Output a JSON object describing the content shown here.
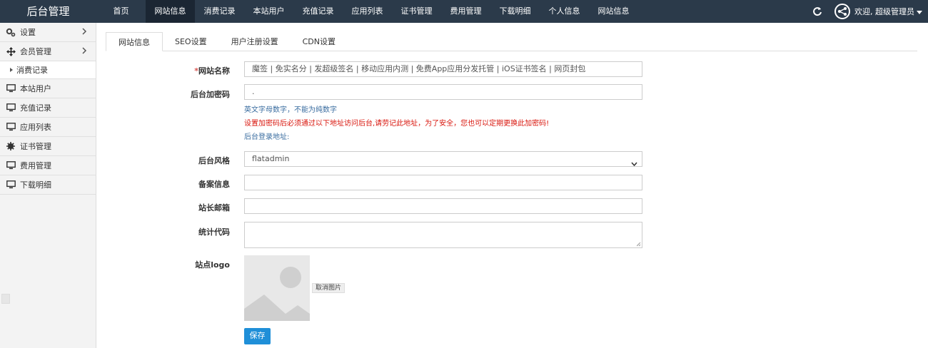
{
  "header": {
    "brand": "后台管理",
    "nav": [
      "首页",
      "网站信息",
      "消费记录",
      "本站用户",
      "充值记录",
      "应用列表",
      "证书管理",
      "费用管理",
      "下载明细",
      "个人信息",
      "网站信息"
    ],
    "active_index": 1,
    "welcome": "欢迎, 超级管理员"
  },
  "sidebar": {
    "items": [
      {
        "label": "设置",
        "icon": "gears-icon"
      },
      {
        "label": "会员管理",
        "icon": "move-arrows-icon"
      }
    ],
    "sub_item": "消费记录",
    "items2": [
      {
        "label": "本站用户",
        "icon": "monitor-icon"
      },
      {
        "label": "充值记录",
        "icon": "monitor-icon"
      },
      {
        "label": "应用列表",
        "icon": "monitor-icon"
      },
      {
        "label": "证书管理",
        "icon": "gear-icon"
      },
      {
        "label": "费用管理",
        "icon": "monitor-icon"
      },
      {
        "label": "下载明细",
        "icon": "monitor-icon"
      }
    ]
  },
  "tabs": [
    "网站信息",
    "SEO设置",
    "用户注册设置",
    "CDN设置"
  ],
  "form": {
    "site_name_label": "网站名称",
    "site_name_required": "*",
    "site_name_value": "魔签 | 免实名分 | 发超级签名 | 移动应用内测 | 免费App应用分发托管 | iOS证书签名 | 网页封包",
    "admin_pass_label": "后台加密码",
    "admin_pass_value": ".",
    "pass_help": "英文字母数字，不能为纯数字",
    "pass_warning": "设置加密码后必须通过以下地址访问后台,请劳记此地址，为了安全，您也可以定期更换此加密码!",
    "login_addr": "后台登录地址:",
    "style_label": "后台风格",
    "style_value": "flatadmin",
    "icp_label": "备案信息",
    "email_label": "站长邮箱",
    "stats_label": "统计代码",
    "logo_label": "站点logo",
    "cancel_image": "取消图片",
    "save": "保存"
  }
}
